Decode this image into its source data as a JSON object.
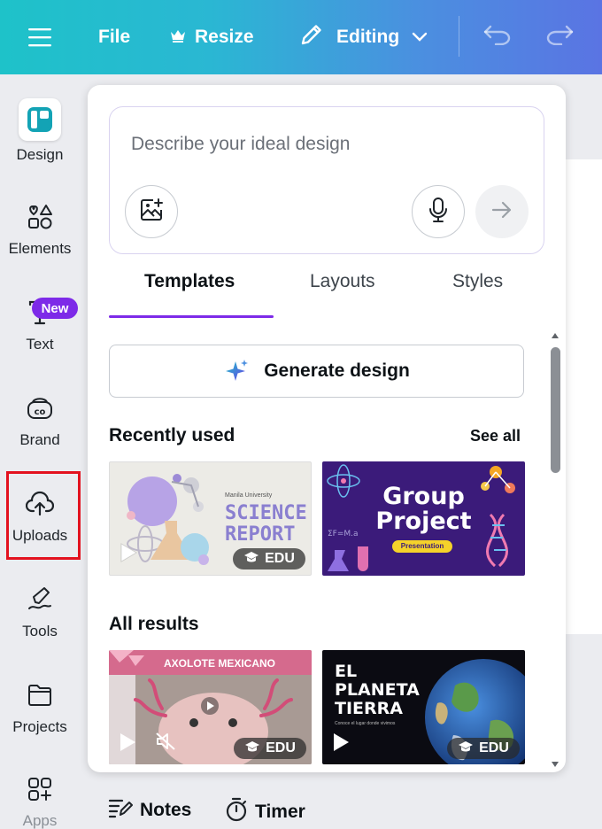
{
  "topbar": {
    "file_label": "File",
    "resize_label": "Resize",
    "editing_label": "Editing"
  },
  "rail": {
    "items": [
      {
        "label": "Design"
      },
      {
        "label": "Elements"
      },
      {
        "label": "Text"
      },
      {
        "label": "Brand"
      },
      {
        "label": "Uploads"
      },
      {
        "label": "Tools"
      },
      {
        "label": "Projects"
      },
      {
        "label": "Apps"
      }
    ],
    "new_badge": "New"
  },
  "panel": {
    "prompt_placeholder": "Describe your ideal design",
    "tabs": [
      {
        "label": "Templates"
      },
      {
        "label": "Layouts"
      },
      {
        "label": "Styles"
      }
    ],
    "generate_label": "Generate design",
    "recently_used_title": "Recently used",
    "see_all_label": "See all",
    "all_results_title": "All results",
    "edu_label": "EDU",
    "thumbs": {
      "science": {
        "university": "Manila University",
        "title_line1": "SCIENCE",
        "title_line2": "REPORT"
      },
      "group": {
        "line1": "Group",
        "line2": "Project",
        "tag": "Presentation"
      },
      "axolote": {
        "title": "AXOLOTE MEXICANO"
      },
      "planeta": {
        "line1": "EL",
        "line2": "PLANETA",
        "line3": "TIERRA",
        "sub": "Conoce el lugar donde vivimos"
      }
    }
  },
  "bottombar": {
    "notes_label": "Notes",
    "timer_label": "Timer"
  },
  "colors": {
    "accent_purple": "#7d2ae8",
    "highlight_red": "#e3121f",
    "topbar_start": "#1ec2c9",
    "topbar_end": "#5a74e3"
  }
}
